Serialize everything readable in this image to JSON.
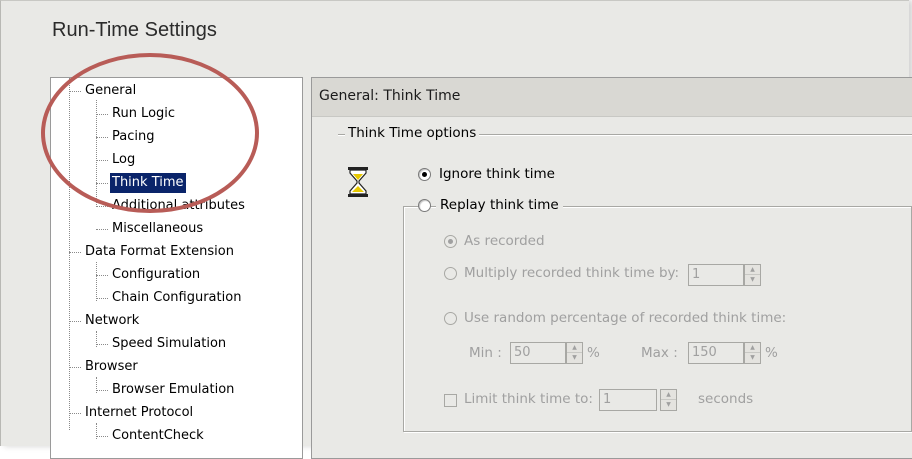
{
  "window": {
    "title": "Run-Time Settings"
  },
  "tree": {
    "items": [
      {
        "label": "General",
        "level": 0
      },
      {
        "label": "Run Logic",
        "level": 1
      },
      {
        "label": "Pacing",
        "level": 1
      },
      {
        "label": "Log",
        "level": 1
      },
      {
        "label": "Think Time",
        "level": 1,
        "selected": true
      },
      {
        "label": "Additional attributes",
        "level": 1
      },
      {
        "label": "Miscellaneous",
        "level": 1
      },
      {
        "label": "Data Format Extension",
        "level": 0
      },
      {
        "label": "Configuration",
        "level": 1
      },
      {
        "label": "Chain Configuration",
        "level": 1
      },
      {
        "label": "Network",
        "level": 0
      },
      {
        "label": "Speed Simulation",
        "level": 1
      },
      {
        "label": "Browser",
        "level": 0
      },
      {
        "label": "Browser Emulation",
        "level": 1
      },
      {
        "label": "Internet Protocol",
        "level": 0
      },
      {
        "label": "ContentCheck",
        "level": 1
      }
    ]
  },
  "panel": {
    "header": "General: Think Time",
    "group_label": "Think Time options",
    "icon": "hourglass-icon",
    "ignore_label": "Ignore think time",
    "ignore_checked": true,
    "replay_label": "Replay think time",
    "replay_checked": false,
    "as_recorded_label": "As recorded",
    "as_recorded_checked": true,
    "multiply_label": "Multiply recorded think time by:",
    "multiply_value": "1",
    "random_label": "Use random percentage of recorded think time:",
    "min_label": "Min :",
    "min_value": "50",
    "max_label": "Max :",
    "max_value": "150",
    "percent_symbol": "%",
    "limit_label": "Limit think time to:",
    "limit_value": "1",
    "limit_checked": false,
    "seconds_label": "seconds"
  },
  "colors": {
    "selection": "#0a246a",
    "annotation_circle": "#b85c57",
    "window_bg": "#e9e9e6"
  }
}
